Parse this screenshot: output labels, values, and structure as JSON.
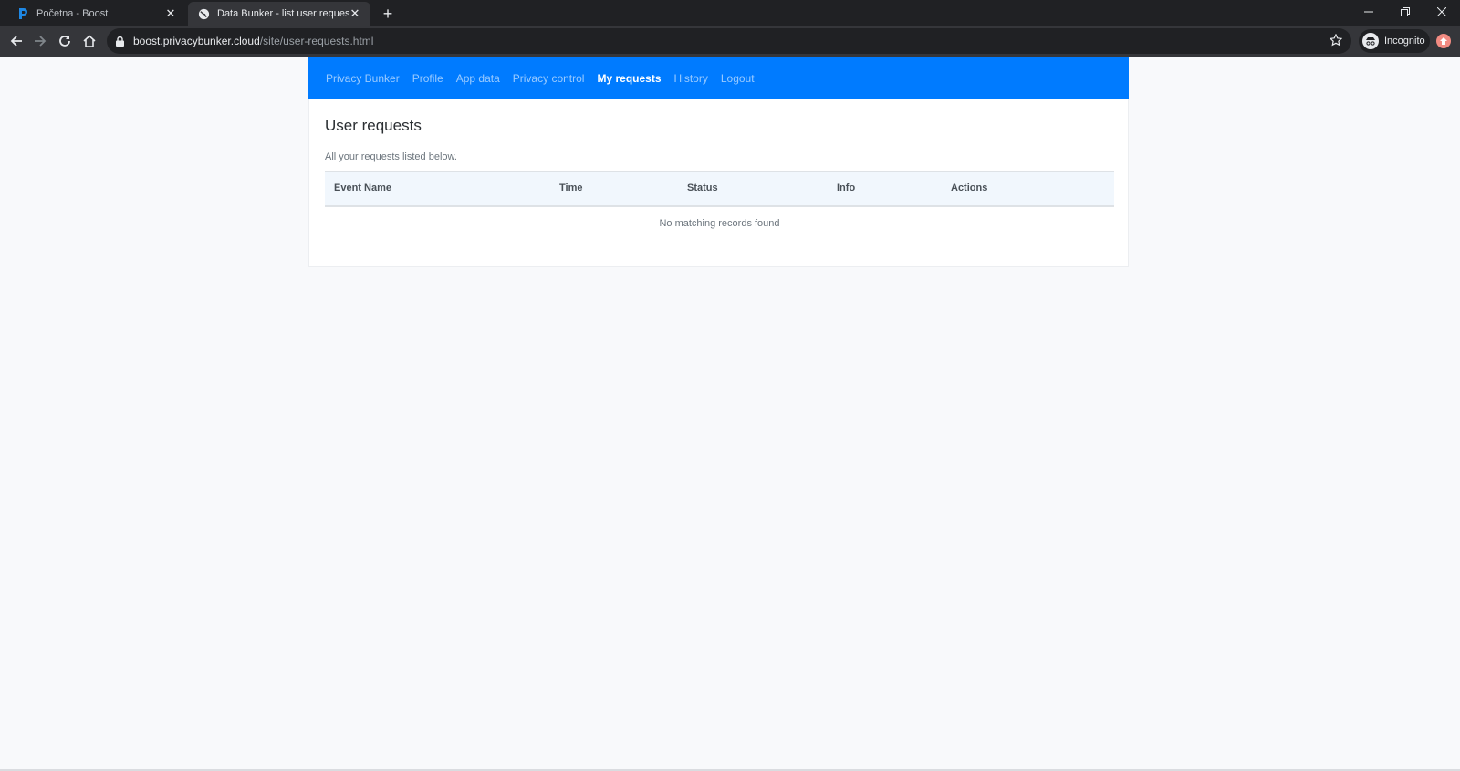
{
  "browser": {
    "tabs": [
      {
        "title": "Početna - Boost"
      },
      {
        "title": "Data Bunker - list user requests"
      }
    ],
    "url_host": "boost.privacybunker.cloud",
    "url_path": "/site/user-requests.html",
    "profile_label": "Incognito"
  },
  "nav": {
    "items": [
      {
        "label": "Privacy Bunker"
      },
      {
        "label": "Profile"
      },
      {
        "label": "App data"
      },
      {
        "label": "Privacy control"
      },
      {
        "label": "My requests"
      },
      {
        "label": "History"
      },
      {
        "label": "Logout"
      }
    ],
    "active": "My requests",
    "color": "#007bff"
  },
  "main": {
    "title": "User requests",
    "subtitle": "All your requests listed below.",
    "table": {
      "columns": [
        "Event Name",
        "Time",
        "Status",
        "Info",
        "Actions"
      ],
      "empty_message": "No matching records found"
    }
  }
}
